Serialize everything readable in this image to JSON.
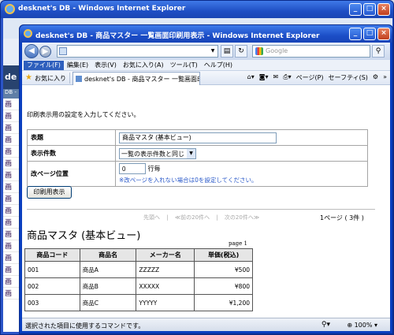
{
  "back_window": {
    "title": "desknet's DB - Windows Internet Explorer",
    "search_placeholder": "Google",
    "sidebar_logo": "de",
    "sidebar_sub": "DB -",
    "sidebar_rows": [
      "画",
      "画",
      "画",
      "画",
      "画",
      "画",
      "画",
      "画",
      "画",
      "画",
      "画",
      "画",
      "画",
      "画",
      "画",
      "画",
      "画"
    ]
  },
  "window": {
    "title": "desknet's DB - 商品マスター 一覧画面印刷用表示 - Windows Internet Explorer",
    "search_placeholder": "Google"
  },
  "menu": [
    "ファイル(F)",
    "編集(E)",
    "表示(V)",
    "お気に入り(A)",
    "ツール(T)",
    "ヘルプ(H)"
  ],
  "favorites": {
    "label": "お気に入り",
    "tab_title": "desknet's DB - 商品マスター 一覧画面印刷...",
    "tools": [
      "ページ(P)",
      "セーフティ(S)"
    ]
  },
  "form": {
    "instruction": "印刷表示用の設定を入力してください。",
    "rows": {
      "title_label": "表題",
      "title_value": "商品マスタ (基本ビュー)",
      "count_label": "表示件数",
      "count_value": "一覧の表示件数と同じ",
      "pagebreak_label": "改ページ位置",
      "pagebreak_value": "0",
      "pagebreak_unit": "行毎",
      "pagebreak_note": "※改ページを入れない場合は0を設定してください。"
    },
    "print_button": "印刷用表示"
  },
  "pager": {
    "first": "先頭へ",
    "prev": "≪前の20件へ",
    "next": "次の20件へ≫",
    "sep": "|",
    "info": "1ページ ( 3件 )"
  },
  "list": {
    "title": "商品マスタ (基本ビュー)",
    "page_label": "page 1",
    "columns": [
      "商品コード",
      "商品名",
      "メーカー名",
      "単価(税込)"
    ],
    "rows": [
      [
        "001",
        "商品A",
        "ZZZZZ",
        "¥500"
      ],
      [
        "002",
        "商品B",
        "XXXXX",
        "¥800"
      ],
      [
        "003",
        "商品C",
        "YYYYY",
        "¥1,200"
      ]
    ]
  },
  "status": {
    "text": "選択された項目に使用するコマンドです。",
    "zoom": "100%"
  },
  "colors": {
    "titlebar": "#1c4ec7",
    "link_note": "#2a59c9"
  }
}
